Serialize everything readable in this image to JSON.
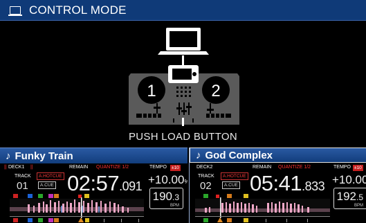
{
  "header": {
    "title": "CONTROL MODE",
    "icon": "monitor-icon"
  },
  "center": {
    "message": "PUSH LOAD BUTTON"
  },
  "decks": [
    {
      "title": "Funky Train",
      "deck_label": "DECK1",
      "remain_label": "REMAIN",
      "quantize": "QUANTIZE 1/2",
      "tempo_label": "TEMPO",
      "tempo_range": "±10",
      "track_label": "TRACK",
      "track_number": "01",
      "hotcue": "A.HOTCUE",
      "acue": "A.CUE",
      "time_main": "02:57",
      "time_ms": ".091",
      "tempo_value": "+10.00",
      "tempo_unit": "%",
      "bpm_int": "190",
      "bpm_dec": ".3",
      "bpm_unit": "BPM"
    },
    {
      "title": "God Complex",
      "deck_label": "DECK2",
      "remain_label": "REMAIN",
      "quantize": "QUANTIZE 1/2",
      "tempo_label": "TEMPO",
      "tempo_range": "±10",
      "track_label": "TRACK",
      "track_number": "02",
      "hotcue": "A.HOTCUE",
      "acue": "A.CUE",
      "time_main": "05:41",
      "time_ms": ".833",
      "tempo_value": "+10.00",
      "tempo_unit": "%",
      "bpm_int": "192",
      "bpm_dec": ".5",
      "bpm_unit": "BPM"
    }
  ],
  "colors": {
    "title_bar": "#0f3a78",
    "deck_header": "#1d4c92",
    "waveform": "#e6a0b8",
    "alert": "#ff3030"
  }
}
